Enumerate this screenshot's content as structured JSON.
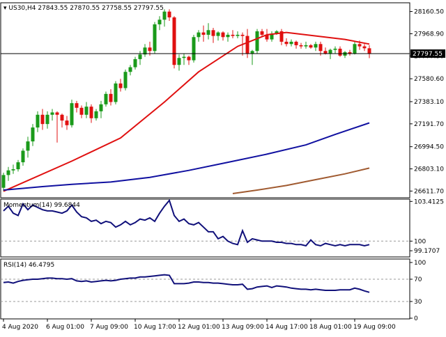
{
  "chart_data": [
    {
      "type": "candlestick",
      "header": {
        "symbol": "US30,H4",
        "open": "27843.55",
        "high": "27870.55",
        "low": "27758.55",
        "close": "27797.55"
      },
      "ylim": [
        26560,
        28230
      ],
      "y_ticks": [
        "28160.50",
        "27968.90",
        "27777.30",
        "27580.60",
        "27383.10",
        "27191.70",
        "26994.50",
        "26803.10",
        "26611.70"
      ],
      "current_price": 27797.55,
      "current_price_label": "27797.55",
      "candles": [
        [
          26640,
          26770,
          26610,
          26750
        ],
        [
          26750,
          26820,
          26700,
          26790
        ],
        [
          26790,
          26840,
          26760,
          26800
        ],
        [
          26800,
          26880,
          26780,
          26860
        ],
        [
          26860,
          26980,
          26830,
          26960
        ],
        [
          26960,
          27080,
          26900,
          27040
        ],
        [
          27040,
          27190,
          27000,
          27160
        ],
        [
          27160,
          27300,
          27120,
          27270
        ],
        [
          27270,
          27320,
          27140,
          27190
        ],
        [
          27190,
          27300,
          27150,
          27270
        ],
        [
          27270,
          27320,
          27220,
          27290
        ],
        [
          27290,
          27300,
          27030,
          27270
        ],
        [
          27270,
          27280,
          27160,
          27220
        ],
        [
          27220,
          27260,
          27140,
          27180
        ],
        [
          27180,
          27400,
          27160,
          27370
        ],
        [
          27370,
          27390,
          27290,
          27330
        ],
        [
          27330,
          27350,
          27240,
          27270
        ],
        [
          27270,
          27380,
          27240,
          27340
        ],
        [
          27340,
          27360,
          27200,
          27240
        ],
        [
          27240,
          27320,
          27220,
          27300
        ],
        [
          27300,
          27390,
          27240,
          27360
        ],
        [
          27360,
          27470,
          27340,
          27450
        ],
        [
          27450,
          27490,
          27350,
          27380
        ],
        [
          27380,
          27560,
          27360,
          27540
        ],
        [
          27540,
          27580,
          27470,
          27500
        ],
        [
          27500,
          27660,
          27480,
          27640
        ],
        [
          27640,
          27700,
          27610,
          27680
        ],
        [
          27680,
          27770,
          27660,
          27750
        ],
        [
          27750,
          27820,
          27700,
          27790
        ],
        [
          27790,
          27880,
          27770,
          27850
        ],
        [
          27850,
          27900,
          27780,
          27820
        ],
        [
          27820,
          28070,
          27800,
          28050
        ],
        [
          28050,
          28120,
          28000,
          28090
        ],
        [
          28090,
          28180,
          28030,
          28160
        ],
        [
          28160,
          28180,
          28080,
          28110
        ],
        [
          28110,
          28120,
          27670,
          27700
        ],
        [
          27700,
          27790,
          27650,
          27760
        ],
        [
          27760,
          27800,
          27700,
          27770
        ],
        [
          27770,
          27780,
          27700,
          27740
        ],
        [
          27740,
          27960,
          27720,
          27940
        ],
        [
          27940,
          28000,
          27900,
          27980
        ],
        [
          27980,
          28040,
          27900,
          27960
        ],
        [
          27960,
          28060,
          27920,
          28000
        ],
        [
          28000,
          28020,
          27890,
          27950
        ],
        [
          27950,
          27990,
          27910,
          27980
        ],
        [
          27980,
          27990,
          27910,
          27940
        ],
        [
          27940,
          27980,
          27900,
          27960
        ],
        [
          27960,
          28000,
          27930,
          27950
        ],
        [
          27950,
          27990,
          27930,
          27960
        ],
        [
          27960,
          27980,
          27780,
          27950
        ],
        [
          27950,
          28010,
          27760,
          27800
        ],
        [
          27800,
          27830,
          27700,
          27820
        ],
        [
          27820,
          28010,
          27800,
          27990
        ],
        [
          27990,
          28010,
          27940,
          27960
        ],
        [
          27960,
          28010,
          27900,
          27920
        ],
        [
          27920,
          27990,
          27900,
          27970
        ],
        [
          27970,
          28000,
          27960,
          27990
        ],
        [
          27990,
          28010,
          27870,
          27900
        ],
        [
          27900,
          27930,
          27860,
          27880
        ],
        [
          27880,
          27920,
          27860,
          27900
        ],
        [
          27900,
          27910,
          27840,
          27870
        ],
        [
          27870,
          27890,
          27840,
          27860
        ],
        [
          27860,
          27900,
          27840,
          27870
        ],
        [
          27870,
          27880,
          27840,
          27850
        ],
        [
          27850,
          27900,
          27820,
          27880
        ],
        [
          27880,
          27900,
          27780,
          27820
        ],
        [
          27820,
          27850,
          27790,
          27800
        ],
        [
          27800,
          27840,
          27750,
          27830
        ],
        [
          27830,
          27860,
          27800,
          27840
        ],
        [
          27840,
          27860,
          27770,
          27780
        ],
        [
          27780,
          27820,
          27760,
          27810
        ],
        [
          27810,
          27830,
          27780,
          27800
        ],
        [
          27800,
          27900,
          27790,
          27880
        ],
        [
          27880,
          27910,
          27830,
          27860
        ],
        [
          27860,
          27880,
          27820,
          27843.55
        ],
        [
          27843.55,
          27870.55,
          27758.55,
          27797.55
        ]
      ],
      "moving_averages": [
        {
          "color": "#e01010",
          "points": [
            [
              0,
              26610
            ],
            [
              14,
              26870
            ],
            [
              24,
              27070
            ],
            [
              33,
              27380
            ],
            [
              40,
              27640
            ],
            [
              48,
              27860
            ],
            [
              54,
              27960
            ],
            [
              58,
              27980
            ],
            [
              64,
              27950
            ],
            [
              70,
              27920
            ],
            [
              75,
              27880
            ]
          ]
        },
        {
          "color": "#1010a0",
          "points": [
            [
              0,
              26620
            ],
            [
              8,
              26650
            ],
            [
              14,
              26670
            ],
            [
              22,
              26690
            ],
            [
              30,
              26730
            ],
            [
              38,
              26790
            ],
            [
              46,
              26860
            ],
            [
              54,
              26930
            ],
            [
              62,
              27010
            ],
            [
              68,
              27100
            ],
            [
              75,
              27200
            ]
          ]
        },
        {
          "color": "#a05a30",
          "points": [
            [
              47,
              26590
            ],
            [
              52,
              26620
            ],
            [
              58,
              26660
            ],
            [
              64,
              26710
            ],
            [
              70,
              26760
            ],
            [
              75,
              26810
            ]
          ]
        }
      ],
      "x_labels": [
        {
          "i": 0,
          "label": "4 Aug 2020"
        },
        {
          "i": 9,
          "label": "6 Aug 01:00"
        },
        {
          "i": 18,
          "label": "7 Aug 09:00"
        },
        {
          "i": 27,
          "label": "10 Aug 17:00"
        },
        {
          "i": 36,
          "label": "12 Aug 01:00"
        },
        {
          "i": 45,
          "label": "13 Aug 09:00"
        },
        {
          "i": 54,
          "label": "14 Aug 17:00"
        },
        {
          "i": 63,
          "label": "18 Aug 01:00"
        },
        {
          "i": 72,
          "label": "19 Aug 09:00"
        }
      ]
    },
    {
      "type": "line",
      "name": "Momentum(14) 99.6844",
      "color": "#10107a",
      "ylim": [
        98.7,
        103.55
      ],
      "y_ticks": [
        {
          "v": 103.4125,
          "label": "103.4125"
        },
        {
          "v": 100,
          "label": "100"
        },
        {
          "v": 99.1707,
          "label": "99.1707"
        }
      ],
      "reference_level": 100,
      "values": [
        102.6,
        103.0,
        102.4,
        102.2,
        103.2,
        102.7,
        103.1,
        102.9,
        102.7,
        102.6,
        102.6,
        102.5,
        102.4,
        102.6,
        103.1,
        102.5,
        102.1,
        102.0,
        101.7,
        101.8,
        101.5,
        101.7,
        101.6,
        101.2,
        101.4,
        101.7,
        101.4,
        101.6,
        101.9,
        101.8,
        102.0,
        101.7,
        102.4,
        103.0,
        103.5,
        102.2,
        101.7,
        101.9,
        101.5,
        101.4,
        101.6,
        101.2,
        100.8,
        100.8,
        100.2,
        100.4,
        100.0,
        99.8,
        99.7,
        100.9,
        99.9,
        100.2,
        100.1,
        100.0,
        100.0,
        100.0,
        99.9,
        99.9,
        99.8,
        99.8,
        99.7,
        99.7,
        99.6,
        100.1,
        99.7,
        99.6,
        99.8,
        99.7,
        99.6,
        99.7,
        99.6,
        99.7,
        99.7,
        99.7,
        99.6,
        99.7
      ]
    },
    {
      "type": "line",
      "name": "RSI(14) 46.4795",
      "color": "#10107a",
      "ylim": [
        0,
        105
      ],
      "y_ticks": [
        {
          "v": 100,
          "label": "100"
        },
        {
          "v": 70,
          "label": "70"
        },
        {
          "v": 30,
          "label": "30"
        },
        {
          "v": 0,
          "label": "0"
        }
      ],
      "levels": [
        70,
        30
      ],
      "values": [
        64,
        65,
        63,
        66,
        68,
        69,
        70,
        70,
        71,
        72,
        72,
        71,
        71,
        70,
        71,
        67,
        66,
        67,
        65,
        66,
        67,
        68,
        67,
        68,
        70,
        71,
        72,
        72,
        74,
        74,
        75,
        76,
        77,
        78,
        77,
        62,
        62,
        62,
        63,
        65,
        65,
        64,
        64,
        63,
        63,
        62,
        61,
        60,
        60,
        61,
        52,
        53,
        56,
        57,
        58,
        55,
        58,
        57,
        56,
        54,
        53,
        52,
        52,
        51,
        52,
        51,
        50,
        50,
        50,
        51,
        51,
        51,
        54,
        52,
        49,
        46.4795
      ]
    }
  ]
}
